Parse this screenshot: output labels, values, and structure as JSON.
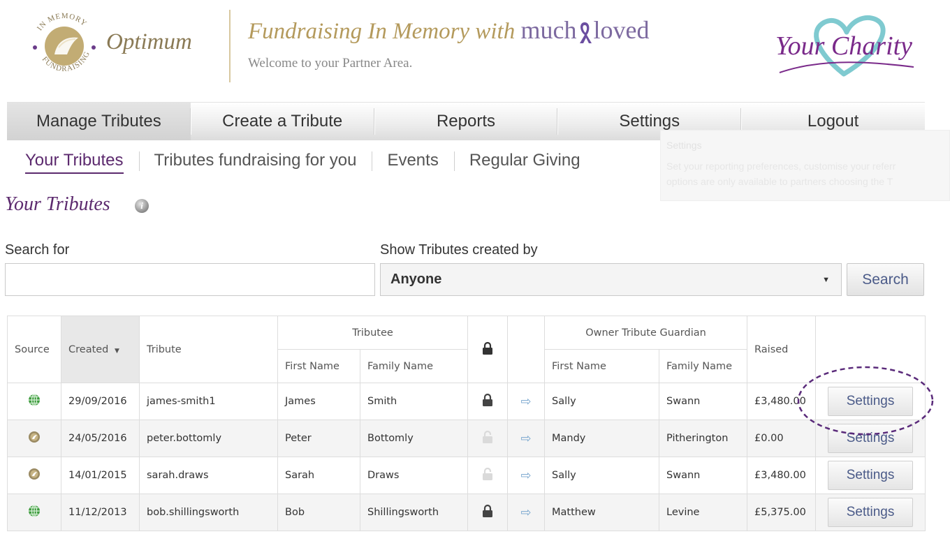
{
  "header": {
    "seal_text": "IN MEMORY FUNDRAISING",
    "org_name": "Optimum",
    "title_prefix": "Fundraising In Memory with",
    "brand_much": "much",
    "brand_loved": "loved",
    "subtitle": "Welcome to your Partner Area.",
    "charity_logo_text": "Your Charity"
  },
  "main_nav": [
    {
      "label": "Manage Tributes",
      "active": true
    },
    {
      "label": "Create a Tribute",
      "active": false
    },
    {
      "label": "Reports",
      "active": false
    },
    {
      "label": "Settings",
      "active": false
    },
    {
      "label": "Logout",
      "active": false
    }
  ],
  "tooltip": {
    "title": "Settings",
    "line1": "Set your reporting preferences, customise your referr",
    "line2": "options are only available to partners choosing the T"
  },
  "sub_nav": [
    {
      "label": "Your Tributes",
      "active": true
    },
    {
      "label": "Tributes fundraising for you",
      "active": false
    },
    {
      "label": "Events",
      "active": false
    },
    {
      "label": "Regular Giving",
      "active": false
    }
  ],
  "page": {
    "title": "Your Tributes"
  },
  "search": {
    "label": "Search for",
    "value": "",
    "created_by_label": "Show Tributes created by",
    "created_by_value": "Anyone",
    "button_label": "Search"
  },
  "table": {
    "headers": {
      "source": "Source",
      "created": "Created",
      "tribute": "Tribute",
      "tributee": "Tributee",
      "first_name": "First Name",
      "family_name": "Family Name",
      "owner": "Owner Tribute Guardian",
      "owner_first_name": "First Name",
      "owner_family_name": "Family Name",
      "raised": "Raised"
    },
    "settings_label": "Settings",
    "rows": [
      {
        "source": "globe-icon",
        "created": "29/09/2016",
        "tribute": "james-smith1",
        "first": "James",
        "family": "Smith",
        "locked": true,
        "owner_first": "Sally",
        "owner_family": "Swann",
        "raised": "£3,480.00"
      },
      {
        "source": "seal-icon",
        "created": "24/05/2016",
        "tribute": "peter.bottomly",
        "first": "Peter",
        "family": "Bottomly",
        "locked": false,
        "owner_first": "Mandy",
        "owner_family": "Pitherington",
        "raised": "£0.00"
      },
      {
        "source": "seal-icon",
        "created": "14/01/2015",
        "tribute": "sarah.draws",
        "first": "Sarah",
        "family": "Draws",
        "locked": false,
        "owner_first": "Sally",
        "owner_family": "Swann",
        "raised": "£3,480.00"
      },
      {
        "source": "globe-icon",
        "created": "11/12/2013",
        "tribute": "bob.shillingsworth",
        "first": "Bob",
        "family": "Shillingsworth",
        "locked": true,
        "owner_first": "Matthew",
        "owner_family": "Levine",
        "raised": "£5,375.00"
      }
    ]
  },
  "colors": {
    "brand_purple": "#5c2a6e",
    "gold": "#b49a5c",
    "link_blue": "#4a5a88",
    "globe_green": "#3c9b3c",
    "highlight_dashed": "#5a2a7a"
  }
}
